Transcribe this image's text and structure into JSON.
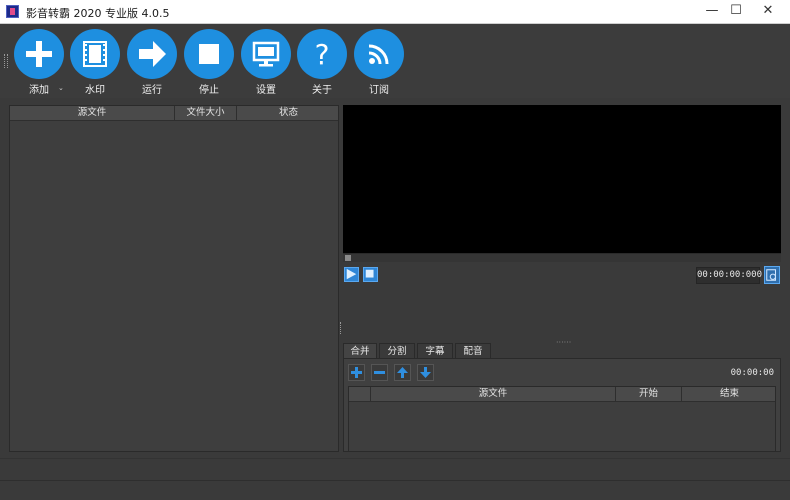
{
  "window": {
    "title": "影音转霸 2020 专业版 4.0.5",
    "minimize": "—",
    "maximize": "☐",
    "close": "✕"
  },
  "toolbar": {
    "buttons": [
      {
        "label": "添加",
        "icon": "plus-icon"
      },
      {
        "label": "水印",
        "icon": "film-icon"
      },
      {
        "label": "运行",
        "icon": "arrow-right-icon"
      },
      {
        "label": "停止",
        "icon": "stop-icon"
      },
      {
        "label": "设置",
        "icon": "monitor-icon"
      },
      {
        "label": "关于",
        "icon": "question-icon"
      },
      {
        "label": "订阅",
        "icon": "rss-icon"
      }
    ],
    "add_dropdown": "⌄"
  },
  "file_list": {
    "columns": [
      "源文件",
      "文件大小",
      "状态"
    ]
  },
  "player": {
    "time": "00:00:00:000"
  },
  "tabs": [
    "合并",
    "分割",
    "字幕",
    "配音"
  ],
  "merge": {
    "total_time": "00:00:00",
    "columns": [
      "源文件",
      "开始",
      "结束"
    ]
  },
  "colors": {
    "accent": "#1e8fe0",
    "background": "#3a3a3a",
    "panel": "#3e3e3e"
  }
}
